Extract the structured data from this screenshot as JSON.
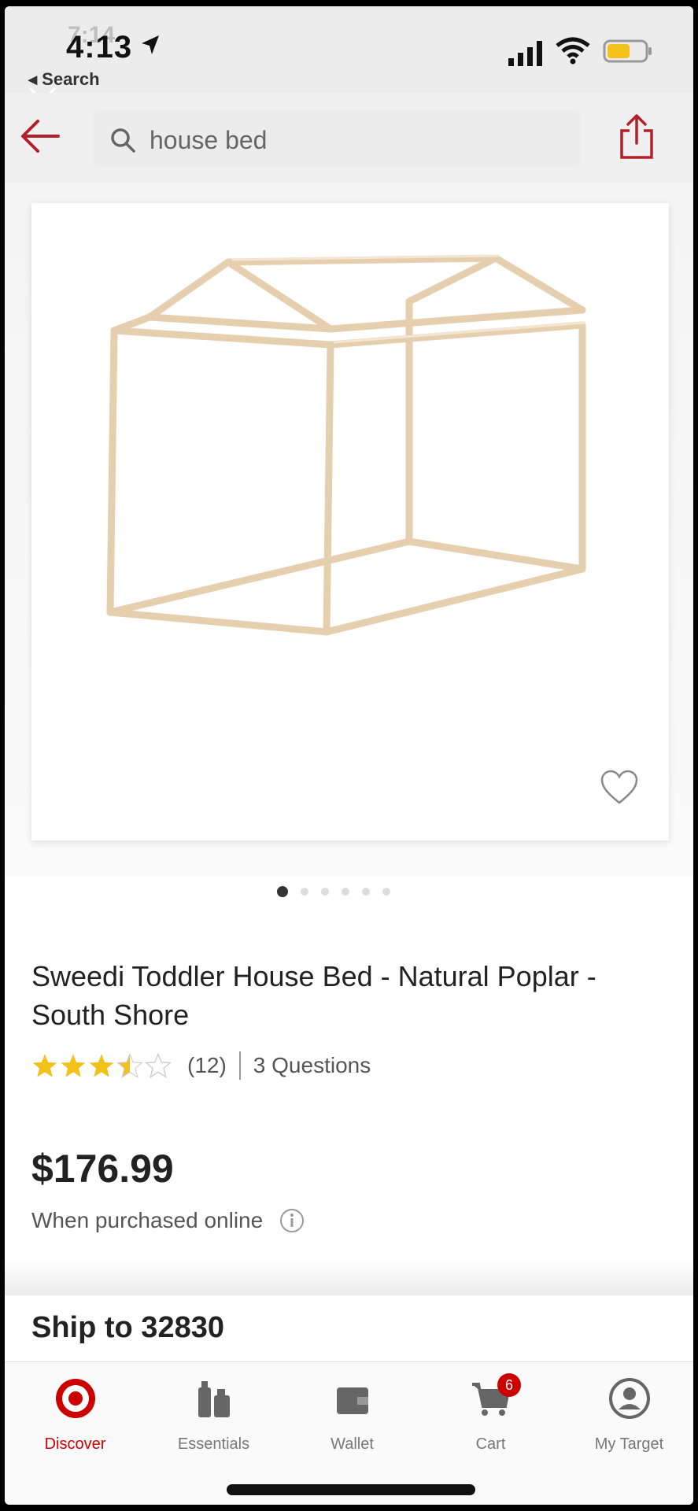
{
  "status_bar": {
    "time": "4:13",
    "time_behind": "7:14",
    "back_to_app": "◂ Search"
  },
  "search": {
    "query": "house bed"
  },
  "product": {
    "title": "Sweedi Toddler House Bed - Natural Poplar - South Shore",
    "rating": 3.5,
    "rating_max": 5,
    "review_count": "(12)",
    "questions": "3 Questions",
    "price": "$176.99",
    "price_note": "When purchased online",
    "image_count": 6,
    "active_image": 1
  },
  "shipping": {
    "label": "Ship to 32830"
  },
  "tabs": [
    {
      "label": "Discover",
      "icon": "target-logo-icon"
    },
    {
      "label": "Essentials",
      "icon": "essentials-icon"
    },
    {
      "label": "Wallet",
      "icon": "wallet-icon"
    },
    {
      "label": "Cart",
      "icon": "cart-icon",
      "badge": "6"
    },
    {
      "label": "My Target",
      "icon": "profile-icon"
    }
  ],
  "colors": {
    "accent": "#cc0000",
    "star": "#f2c21b",
    "wood": "#e9d2b3"
  }
}
